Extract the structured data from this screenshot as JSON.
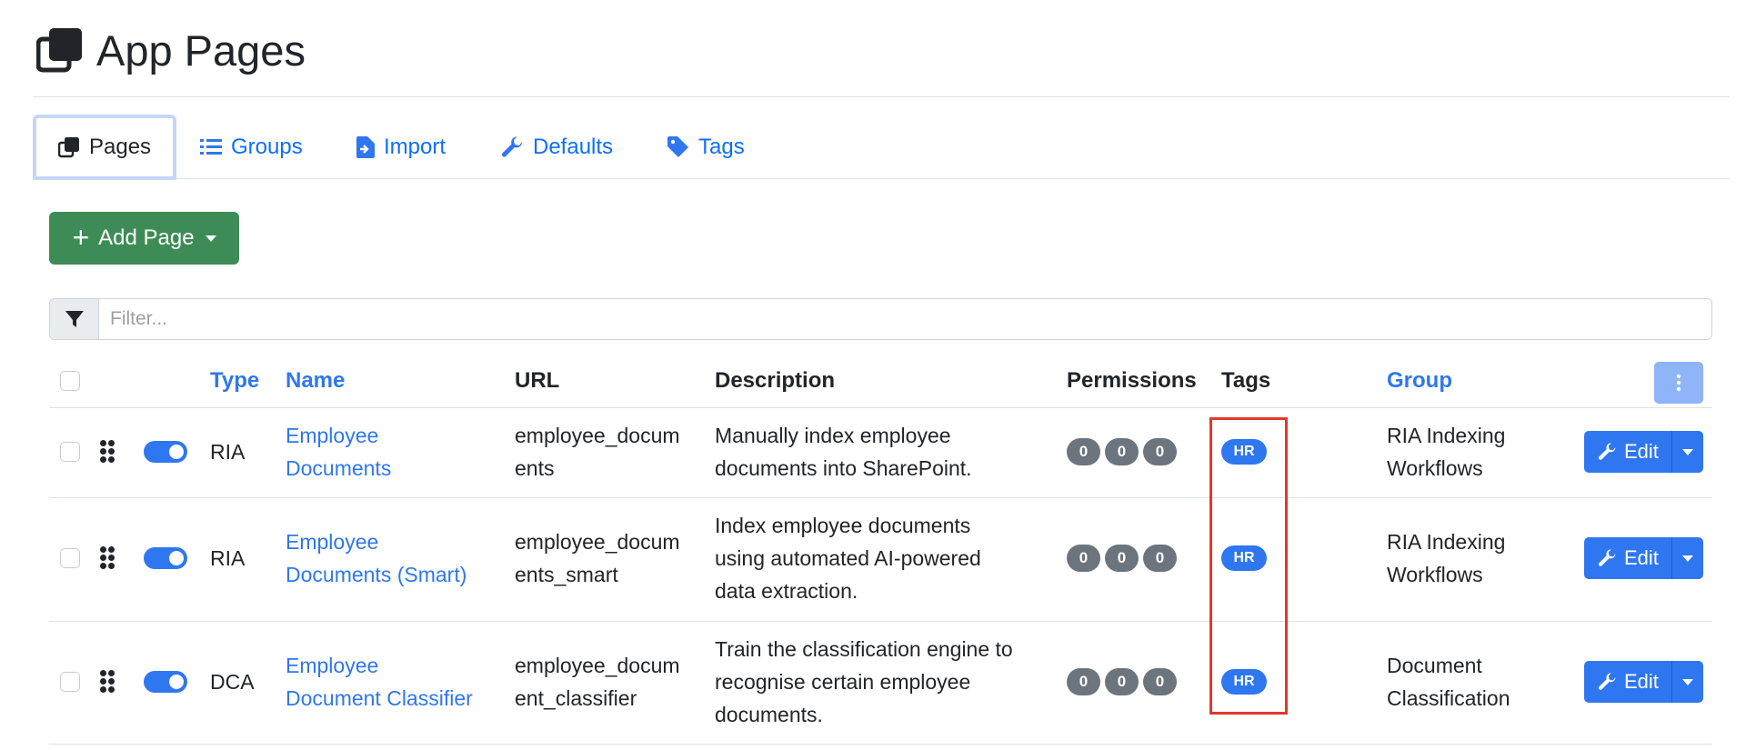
{
  "header": {
    "title": "App Pages",
    "icon": "copy-icon"
  },
  "tabs": [
    {
      "label": "Pages",
      "icon": "copy-icon",
      "active": true
    },
    {
      "label": "Groups",
      "icon": "list-icon"
    },
    {
      "label": "Import",
      "icon": "file-import-icon"
    },
    {
      "label": "Defaults",
      "icon": "wrench-icon"
    },
    {
      "label": "Tags",
      "icon": "tag-icon"
    }
  ],
  "add_button": {
    "label": "Add Page"
  },
  "filter": {
    "placeholder": "Filter..."
  },
  "columns": {
    "type": "Type",
    "name": "Name",
    "url": "URL",
    "description": "Description",
    "permissions": "Permissions",
    "tags": "Tags",
    "group": "Group"
  },
  "rows": [
    {
      "type": "RIA",
      "name_lines": [
        "Employee",
        "Documents"
      ],
      "url_lines": [
        "employee_docum",
        "ents"
      ],
      "description_lines": [
        "Manually index employee",
        "documents into SharePoint."
      ],
      "permissions": [
        "0",
        "0",
        "0"
      ],
      "tag": "HR",
      "group_lines": [
        "RIA Indexing",
        "Workflows"
      ],
      "edit_label": "Edit",
      "enabled": true
    },
    {
      "type": "RIA",
      "name_lines": [
        "Employee",
        "Documents (Smart)"
      ],
      "url_lines": [
        "employee_docum",
        "ents_smart"
      ],
      "description_lines": [
        "Index employee documents",
        "using automated AI-powered",
        "data extraction."
      ],
      "permissions": [
        "0",
        "0",
        "0"
      ],
      "tag": "HR",
      "group_lines": [
        "RIA Indexing",
        "Workflows"
      ],
      "edit_label": "Edit",
      "enabled": true
    },
    {
      "type": "DCA",
      "name_lines": [
        "Employee",
        "Document Classifier"
      ],
      "url_lines": [
        "employee_docum",
        "ent_classifier"
      ],
      "description_lines": [
        "Train the classification engine to",
        "recognise certain employee",
        "documents."
      ],
      "permissions": [
        "0",
        "0",
        "0"
      ],
      "tag": "HR",
      "group_lines": [
        "Document",
        "Classification"
      ],
      "edit_label": "Edit",
      "enabled": true
    }
  ],
  "colors": {
    "primary": "#2f77f0",
    "success": "#3d8c55",
    "secondary": "#6c757d",
    "highlight": "#e0392b"
  }
}
